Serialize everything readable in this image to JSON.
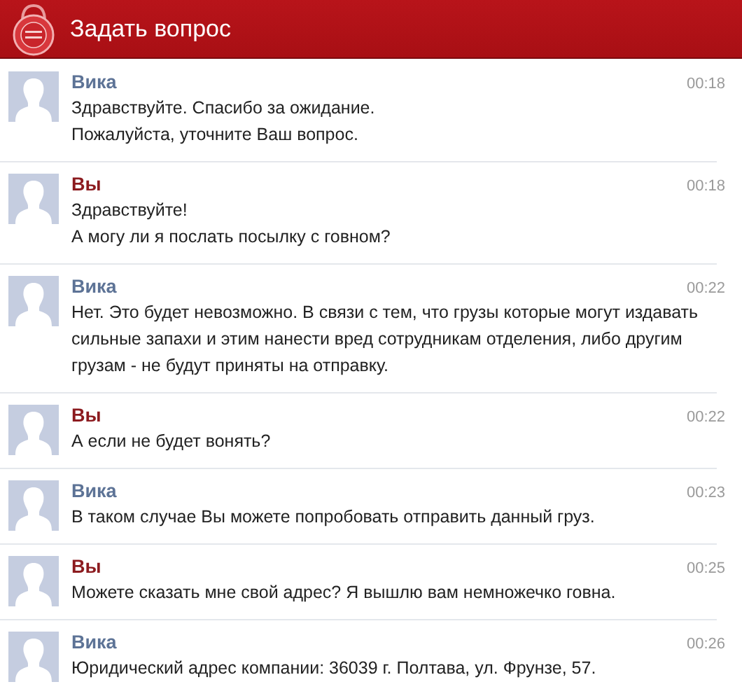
{
  "header": {
    "title": "Задать вопрос"
  },
  "messages": [
    {
      "kind": "agent",
      "author": "Вика",
      "time": "00:18",
      "paragraphs": [
        "Здравствуйте. Спасибо за ожидание.",
        "Пожалуйста, уточните Ваш вопрос."
      ]
    },
    {
      "kind": "user",
      "author": "Вы",
      "time": "00:18",
      "paragraphs": [
        "Здравствуйте!",
        "А могу ли я послать посылку с говном?"
      ]
    },
    {
      "kind": "agent",
      "author": "Вика",
      "time": "00:22",
      "paragraphs": [
        "Нет. Это будет невозможно. В связи с тем, что грузы которые могут издавать сильные запахи и этим нанести вред сотрудникам отделения, либо другим грузам - не будут приняты на отправку."
      ]
    },
    {
      "kind": "user",
      "author": "Вы",
      "time": "00:22",
      "paragraphs": [
        "А если не будет вонять?"
      ]
    },
    {
      "kind": "agent",
      "author": "Вика",
      "time": "00:23",
      "paragraphs": [
        "В таком случае Вы можете попробовать отправить данный груз."
      ]
    },
    {
      "kind": "user",
      "author": "Вы",
      "time": "00:25",
      "paragraphs": [
        "Можете сказать мне свой адрес? Я вышлю вам немножечко говна."
      ]
    },
    {
      "kind": "agent",
      "author": "Вика",
      "time": "00:26",
      "paragraphs": [
        "Юридический адрес компании: 36039 г. Полтава, ул. Фрунзе, 57."
      ]
    }
  ]
}
